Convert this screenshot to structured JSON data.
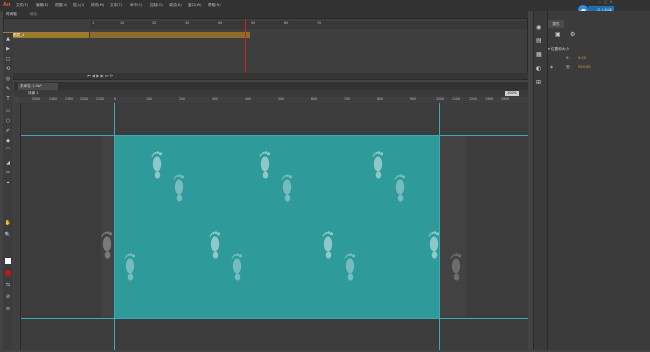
{
  "app": {
    "logo": "An",
    "menus": [
      "文件(F)",
      "编辑(E)",
      "视图(V)",
      "插入(I)",
      "修改(M)",
      "文本(T)",
      "命令(C)",
      "控制(O)",
      "调试(D)",
      "窗口(W)",
      "帮助(H)"
    ],
    "window_controls": [
      "—",
      "□",
      "✕"
    ],
    "upgrade_label": "马上升级",
    "brand_color": "#e0572a",
    "accent_color": "#1f6fb3"
  },
  "timeline": {
    "tabs": [
      "时间轴",
      "输出"
    ],
    "ruler_ticks": [
      "1",
      "5",
      "10",
      "15",
      "20",
      "25",
      "30",
      "35",
      "40",
      "45",
      "50",
      "55",
      "60",
      "65",
      "70",
      "75"
    ],
    "layer_name": "图层_1",
    "playhead_color": "#d21f1f"
  },
  "toolbar": {
    "tools": [
      "▲",
      "▶",
      "◻",
      "⟲",
      "◎",
      "✎",
      "T",
      "▭",
      "○",
      "✐",
      "◆",
      "⌒",
      "◢",
      "✂",
      "⌖",
      "✋",
      "🔍",
      "■",
      "■",
      "⇆",
      "⊘",
      "≡"
    ]
  },
  "document": {
    "tab_label": "未命名-1.fla*",
    "scene_label": "场景 1",
    "zoom": "100%",
    "ruler_labels": [
      "2500",
      "2400",
      "2300",
      "2200",
      "2100",
      "0",
      "100",
      "200",
      "300",
      "400",
      "500",
      "600",
      "700",
      "800",
      "900",
      "1000",
      "1100",
      "1200",
      "1300",
      "1900",
      "2000",
      "2100",
      "2200",
      "2300"
    ],
    "stage_color": "#2e9a9a"
  },
  "library": {
    "tab_label": "属性",
    "section_title": "位置和大小",
    "rows": [
      {
        "col1": "X:",
        "col2": "0.00"
      },
      {
        "col1": "宽:",
        "col2": "550.00"
      }
    ]
  }
}
